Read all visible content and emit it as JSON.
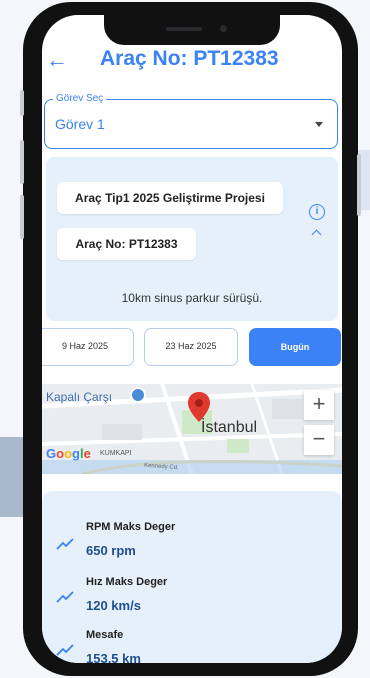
{
  "header": {
    "title": "Araç No: PT12383"
  },
  "select": {
    "label": "Görev Seç",
    "value": "Görev 1"
  },
  "info": {
    "project": "Araç Tip1 2025 Geliştirme Projesi",
    "vehicle": "Araç No: PT12383",
    "description": "10km sinus parkur sürüşü."
  },
  "dates": {
    "start": "9 Haz 2025",
    "end": "23 Haz 2025",
    "today": "Bugün"
  },
  "map": {
    "kapali": "Kapalı Çarşı",
    "istanbul": "İstanbul",
    "kumkapi": "KUMKAPI",
    "small": "Kennedy Cd.",
    "google": "Google",
    "zoom_in": "+",
    "zoom_out": "−"
  },
  "stats": [
    {
      "label": "RPM Maks Deger",
      "value": "650 rpm"
    },
    {
      "label": "Hız Maks Deger",
      "value": "120 km/s"
    },
    {
      "label": "Mesafe",
      "value": "153.5 km"
    }
  ],
  "colors": {
    "accent": "#3b82f6",
    "card_bg": "#e5f0fb",
    "value_text": "#1f4f8f"
  }
}
